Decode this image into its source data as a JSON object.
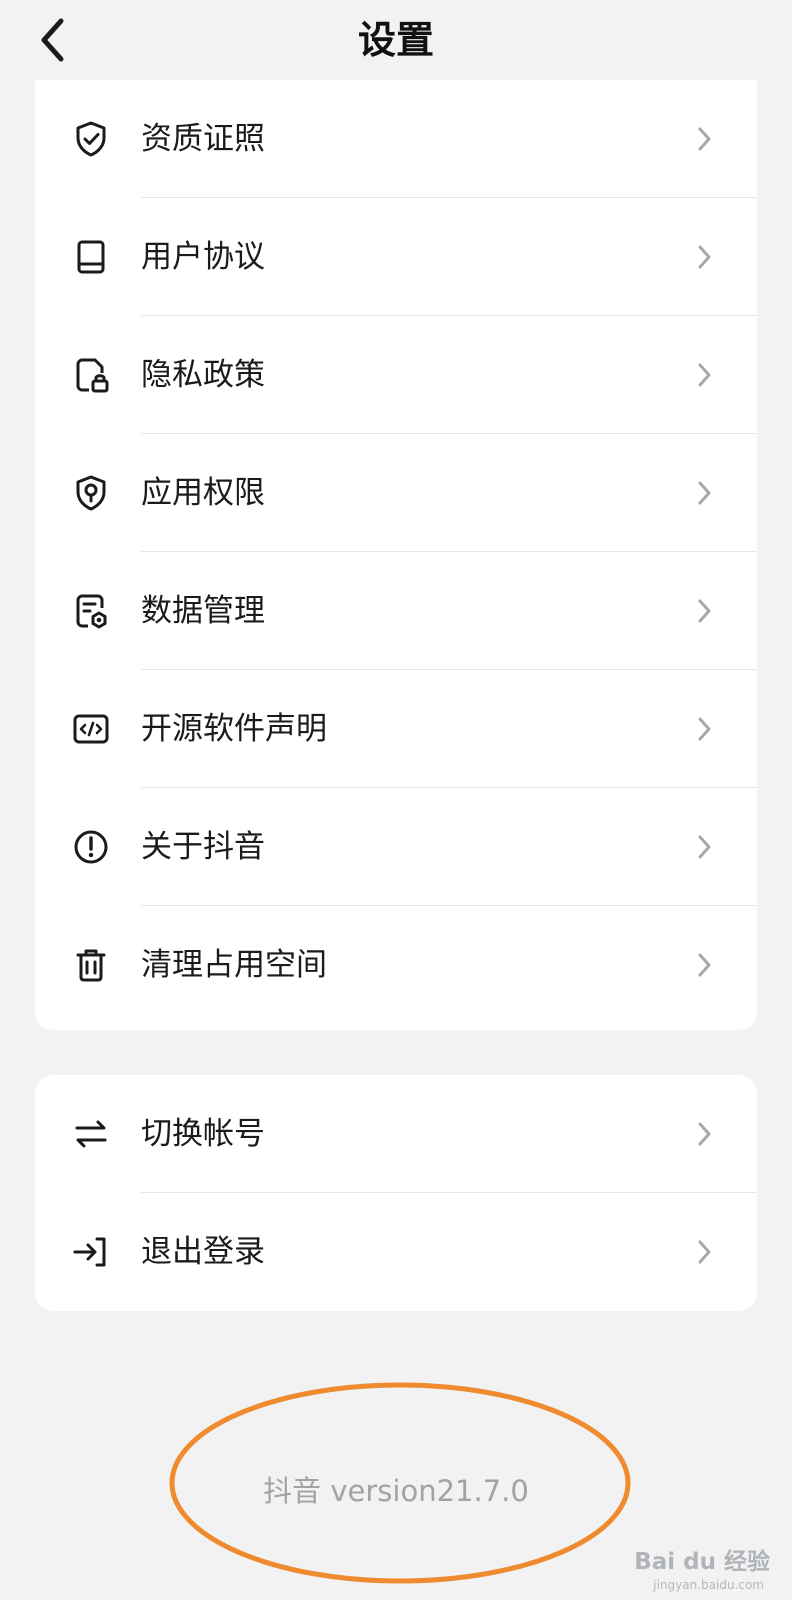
{
  "header": {
    "title": "设置",
    "back_icon": "chevron-left-icon"
  },
  "settings_card": {
    "items": [
      {
        "label": "资质证照",
        "icon": "shield-check-icon"
      },
      {
        "label": "用户协议",
        "icon": "book-icon"
      },
      {
        "label": "隐私政策",
        "icon": "document-lock-icon"
      },
      {
        "label": "应用权限",
        "icon": "shield-keyhole-icon"
      },
      {
        "label": "数据管理",
        "icon": "data-gear-icon"
      },
      {
        "label": "开源软件声明",
        "icon": "code-window-icon"
      },
      {
        "label": "关于抖音",
        "icon": "info-circle-icon"
      },
      {
        "label": "清理占用空间",
        "icon": "trash-icon"
      }
    ]
  },
  "account_card": {
    "items": [
      {
        "label": "切换帐号",
        "icon": "swap-arrows-icon"
      },
      {
        "label": "退出登录",
        "icon": "logout-arrow-icon"
      }
    ]
  },
  "footer": {
    "version": "抖音 version21.7.0"
  },
  "watermark": {
    "brand": "Bai du 经验",
    "site": "jingyan.baidu.com"
  },
  "colors": {
    "background": "#f2f2f2",
    "card": "#ffffff",
    "text": "#1b1b1f",
    "chevron": "#a8a8a8",
    "annotation": "#f08a2f"
  }
}
